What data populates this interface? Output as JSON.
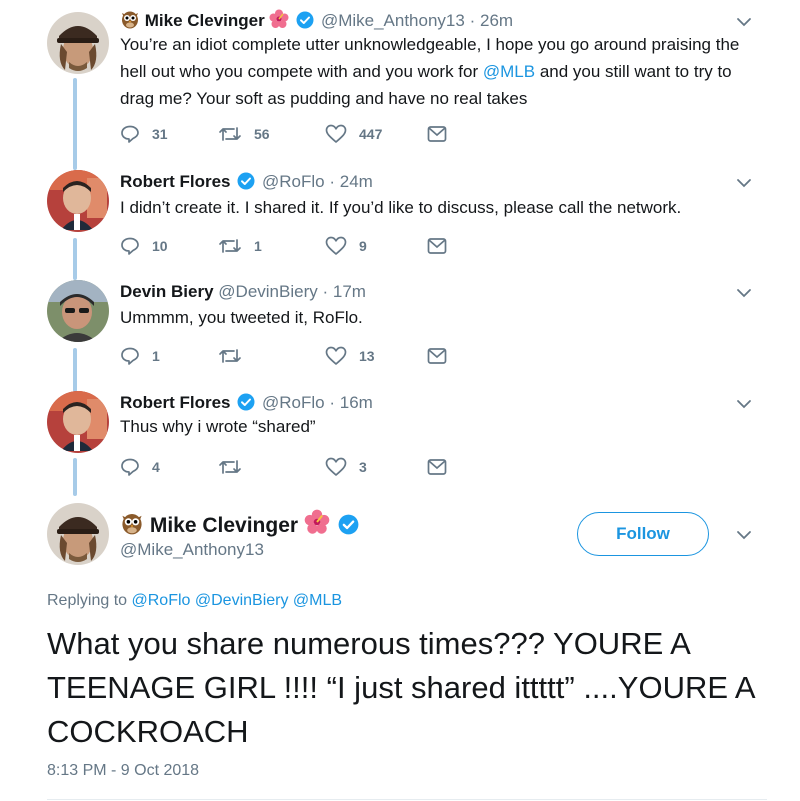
{
  "thread": [
    {
      "name": "Mike Clevinger",
      "handle": "@Mike_Anthony13",
      "time": "26m",
      "text_parts": [
        "You’re an idiot complete utter unknowledgeable, I hope you go around praising the hell out who you compete with and you work for ",
        "@MLB",
        "  and you still want to try to drag me? Your soft as pudding and have no real takes"
      ],
      "replies": "31",
      "retweets": "56",
      "likes": "447"
    },
    {
      "name": "Robert Flores",
      "handle": "@RoFlo",
      "time": "24m",
      "text": "I didn’t create it. I shared it. If you’d like to discuss, please call the network.",
      "replies": "10",
      "retweets": "1",
      "likes": "9"
    },
    {
      "name": "Devin Biery",
      "handle": "@DevinBiery",
      "time": "17m",
      "text": "Ummmm, you tweeted it, RoFlo.",
      "replies": "1",
      "retweets": "",
      "likes": "13"
    },
    {
      "name": "Robert Flores",
      "handle": "@RoFlo",
      "time": "16m",
      "text": "Thus why i wrote “shared”",
      "replies": "4",
      "retweets": "",
      "likes": "3"
    }
  ],
  "main": {
    "name": "Mike Clevinger",
    "handle": "@Mike_Anthony13",
    "follow_label": "Follow",
    "replying_prefix": "Replying to ",
    "replying_to": "@RoFlo @DevinBiery @MLB",
    "text": "What you share numerous times??? YOURE A TEENAGE GIRL !!!! “I just shared ittttt” ....YOURE A COCKROACH",
    "timestamp": "8:13 PM - 9 Oct 2018"
  },
  "separator": "·",
  "icons": {
    "owl": "owl-emoji-icon",
    "flower": "hibiscus-emoji-icon",
    "verified": "verified-badge-icon",
    "caret": "chevron-down-icon",
    "reply": "reply-icon",
    "retweet": "retweet-icon",
    "like": "heart-icon",
    "dm": "envelope-icon"
  },
  "colors": {
    "link": "#1b95e0",
    "muted": "#657786",
    "thread_line": "#a7cbe8",
    "text": "#14171a"
  }
}
